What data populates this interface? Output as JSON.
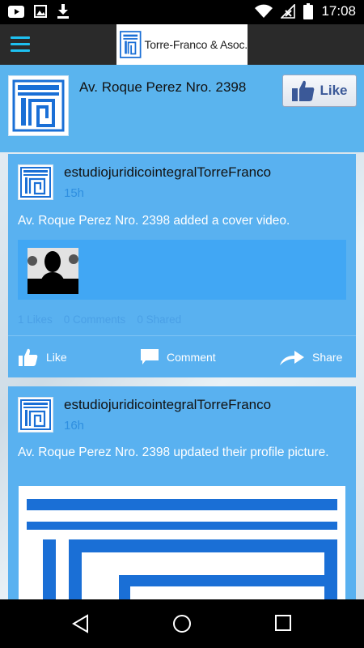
{
  "status_bar": {
    "time": "17:08",
    "left_icons": [
      "youtube-icon",
      "image-icon",
      "download-icon"
    ],
    "right_icons": [
      "wifi-icon",
      "no-signal-icon",
      "battery-icon"
    ]
  },
  "app_bar": {
    "brand_name": "Torre-Franco & Asoc.",
    "menu_icon": "hamburger-icon"
  },
  "page_header": {
    "title": "Av. Roque Perez Nro. 2398",
    "like_button_label": "Like"
  },
  "posts": [
    {
      "author": "estudiojuridicointegralTorreFranco",
      "time": "15h",
      "text": "Av. Roque Perez Nro. 2398 added a cover video.",
      "stats": {
        "likes": "1 Likes",
        "comments": "0 Comments",
        "shared": "0 Shared"
      },
      "actions": {
        "like": "Like",
        "comment": "Comment",
        "share": "Share"
      }
    },
    {
      "author": "estudiojuridicointegralTorreFranco",
      "time": "16h",
      "text": "Av. Roque Perez Nro. 2398 updated their profile picture."
    }
  ],
  "nav_bar": {
    "buttons": [
      "back-icon",
      "home-icon",
      "recents-icon"
    ]
  },
  "colors": {
    "accent": "#1ec0f0",
    "card_blue": "#59b1f0",
    "logo_blue": "#1a6fd6",
    "timestamp_blue": "#2e8fe0",
    "app_bar": "#2a2a2a"
  }
}
